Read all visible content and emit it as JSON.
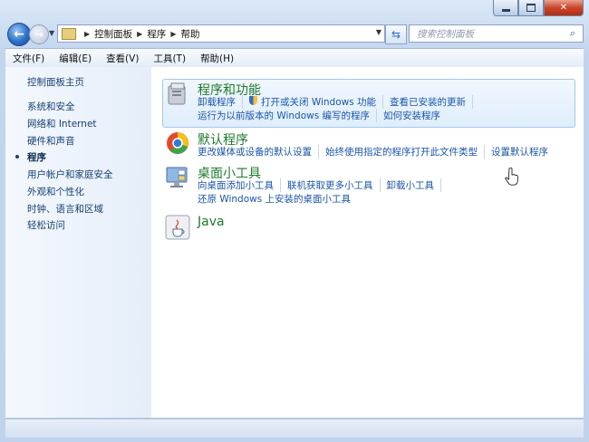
{
  "window": {
    "caption_minimize": "minimize-icon",
    "caption_maximize": "maximize-icon",
    "caption_close": "✕"
  },
  "nav": {
    "breadcrumbs": [
      "控制面板",
      "程序",
      "帮助"
    ],
    "search_placeholder": "搜索控制面板"
  },
  "menu": [
    "文件(F)",
    "编辑(E)",
    "查看(V)",
    "工具(T)",
    "帮助(H)"
  ],
  "sidebar": {
    "home": "控制面板主页",
    "items": [
      "系统和安全",
      "网络和 Internet",
      "硬件和声音",
      "程序",
      "用户帐户和家庭安全",
      "外观和个性化",
      "时钟、语言和区域",
      "轻松访问"
    ],
    "current_index": 3
  },
  "categories": [
    {
      "title": "程序和功能",
      "rows": [
        [
          "卸载程序",
          "打开或关闭 Windows 功能",
          "查看已安装的更新"
        ],
        [
          "运行为以前版本的 Windows 编写的程序",
          "如何安装程序"
        ]
      ]
    },
    {
      "title": "默认程序",
      "rows": [
        [
          "更改媒体或设备的默认设置",
          "始终使用指定的程序打开此文件类型",
          "设置默认程序"
        ]
      ]
    },
    {
      "title": "桌面小工具",
      "rows": [
        [
          "向桌面添加小工具",
          "联机获取更多小工具",
          "卸载小工具"
        ],
        [
          "还原 Windows 上安装的桌面小工具"
        ]
      ]
    },
    {
      "title": "Java",
      "rows": []
    }
  ],
  "colors": {
    "category_title": "#1e7a2a",
    "link": "#1a55a8",
    "highlight_border": "#a5c6ec"
  }
}
